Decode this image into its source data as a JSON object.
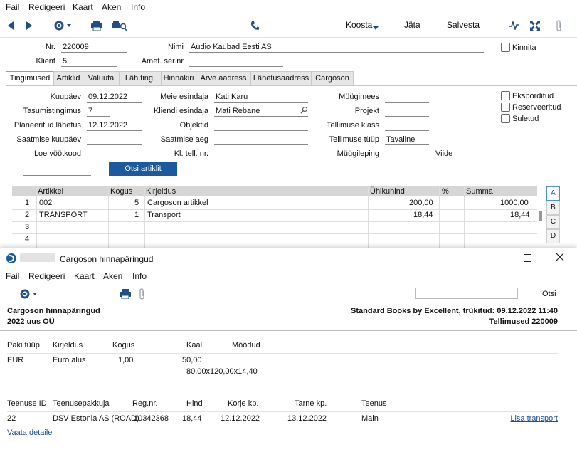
{
  "menu": [
    "Fail",
    "Redigeeri",
    "Kaart",
    "Aken",
    "Info"
  ],
  "toolbar": {
    "koosta": "Koosta",
    "jata": "Jäta",
    "salvesta": "Salvesta"
  },
  "header": {
    "nr_label": "Nr.",
    "nr_value": "220009",
    "nimi_label": "Nimi",
    "nimi_value": "Audio Kaubad Eesti AS",
    "kinnita_label": "Kinnita",
    "klient_label": "Klient",
    "klient_value": "5",
    "amet_label": "Amet. ser.nr",
    "amet_value": ""
  },
  "tabs": [
    "Tingimused",
    "Artiklid",
    "Valuuta",
    "Läh.ting.",
    "Hinnakiri",
    "Arve aadress",
    "Lähetusaadress",
    "Cargoson"
  ],
  "form": {
    "kuupaev_label": "Kuupäev",
    "kuupaev_value": "09.12.2022",
    "meie_label": "Meie esindaja",
    "meie_value": "Kati Karu",
    "muugimees_label": "Müügimees",
    "muugimees_value": "",
    "tasumis_label": "Tasumistingimus",
    "tasumis_value": "7",
    "kliendi_label": "Kliendi esindaja",
    "kliendi_value": "Mati Rebane",
    "projekt_label": "Projekt",
    "projekt_value": "",
    "plan_label": "Planeeritud lähetus",
    "plan_value": "12.12.2022",
    "objektid_label": "Objektid",
    "objektid_value": "",
    "tklass_label": "Tellimuse klass",
    "tklass_value": "",
    "skuupaev_label": "Saatmise kuupäev",
    "skuupaev_value": "",
    "saeg_label": "Saatmise aeg",
    "saeg_value": "",
    "ttuup_label": "Tellimuse tüüp",
    "ttuup_value": "Tavaline",
    "loe_label": "Loe vöötkood",
    "loe_value": "",
    "kltell_label": "Kl. tell. nr.",
    "kltell_value": "",
    "muugileping_label": "Müügileping",
    "muugileping_value": "",
    "viide_label": "Viide",
    "viide_value": "",
    "eksporditud": "Eksporditud",
    "reserveeritud": "Reserveeritud",
    "suletud": "Suletud",
    "otsi_btn": "Otsi artiklit"
  },
  "grid": {
    "headers": {
      "artikkel": "Artikkel",
      "kogus": "Kogus",
      "kirjeldus": "Kirjeldus",
      "uhikuhind": "Ühikuhind",
      "pct": "%",
      "summa": "Summa"
    },
    "rows": [
      {
        "n": "1",
        "artikkel": "002",
        "kogus": "5",
        "kirjeldus": "Cargoson artikkel",
        "uhikuhind": "200,00",
        "pct": "",
        "summa": "1000,00"
      },
      {
        "n": "2",
        "artikkel": "TRANSPORT",
        "kogus": "1",
        "kirjeldus": "Transport",
        "uhikuhind": "18,44",
        "pct": "",
        "summa": "18,44"
      },
      {
        "n": "3",
        "artikkel": "",
        "kogus": "",
        "kirjeldus": "",
        "uhikuhind": "",
        "pct": "",
        "summa": ""
      },
      {
        "n": "4",
        "artikkel": "",
        "kogus": "",
        "kirjeldus": "",
        "uhikuhind": "",
        "pct": "",
        "summa": ""
      }
    ],
    "side_tabs": [
      "A",
      "B",
      "C",
      "D"
    ]
  },
  "popup": {
    "title": "Cargoson hinnapäringud",
    "menu": [
      "Fail",
      "Redigeeri",
      "Kaart",
      "Aken",
      "Info"
    ],
    "search_placeholder": "",
    "otsi": "Otsi",
    "report_title": "Cargoson hinnapäringud",
    "report_sub": "2022 uus OÜ",
    "report_right1": "Standard Books by Excellent, trükitud: 09.12.2022 11:40",
    "report_right2": "Tellimused 220009",
    "pkg_headers": {
      "tyyp": "Paki tüüp",
      "kirjeldus": "Kirjeldus",
      "kogus": "Kogus",
      "kaal": "Kaal",
      "moodud": "Mõõdud"
    },
    "pkg_row": {
      "tyyp": "EUR",
      "kirjeldus": "Euro alus",
      "kogus": "1,00",
      "kaal": "50,00",
      "moodud": "80,00x120,00x14,40"
    },
    "svc_headers": {
      "id": "Teenuse ID",
      "pakkuja": "Teenusepakkuja",
      "regnr": "Reg.nr.",
      "hind": "Hind",
      "korje": "Korje kp.",
      "tarne": "Tarne kp.",
      "teenus": "Teenus"
    },
    "svc_row": {
      "id": "22",
      "pakkuja": "DSV Estonia AS (ROAD)",
      "regnr": "10342368",
      "hind": "18,44",
      "korje": "12.12.2022",
      "tarne": "13.12.2022",
      "teenus": "Main",
      "action": "Lisa transport"
    },
    "vaata": "Vaata detaile"
  }
}
